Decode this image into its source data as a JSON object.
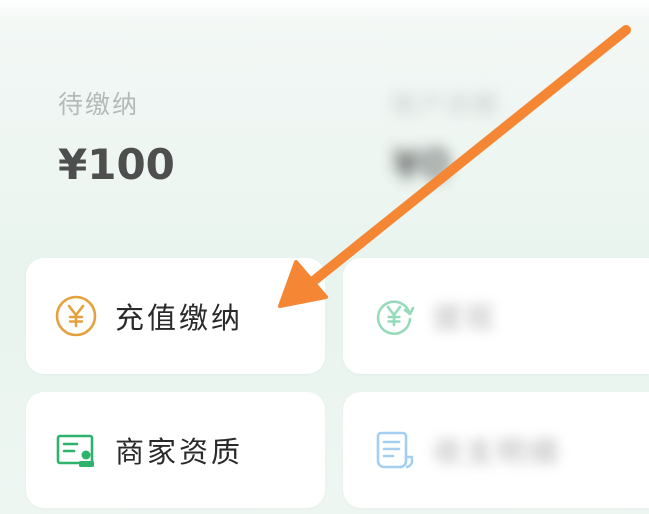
{
  "balance": {
    "pending": {
      "label": "待缴纳",
      "value": "¥100"
    },
    "other": {
      "label": "账户余额",
      "value": "¥0"
    }
  },
  "actions": [
    {
      "label": "充值缴纳",
      "icon": "yen-coin-icon",
      "color": "#e5a13c"
    },
    {
      "label": "提现",
      "icon": "yen-refresh-icon",
      "color": "#3fbf82"
    },
    {
      "label": "商家资质",
      "icon": "merchant-license-icon",
      "color": "#2db36b"
    },
    {
      "label": "收支明细",
      "icon": "receipt-icon",
      "color": "#5aa9e6"
    }
  ],
  "colors": {
    "arrow": "#f58634",
    "background": "#eef5f1",
    "card": "#ffffff"
  }
}
